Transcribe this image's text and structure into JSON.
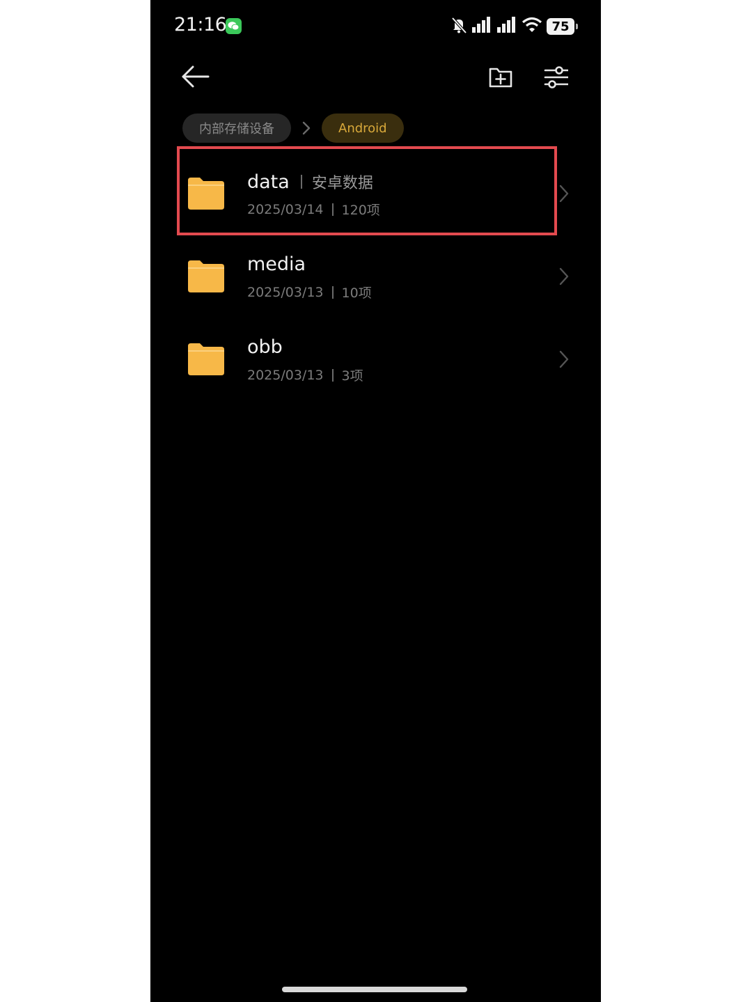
{
  "status_bar": {
    "time": "21:16",
    "notification_app_icon": "wechat-icon",
    "icons": [
      "mute-bell-icon",
      "signal-icon",
      "signal-icon",
      "wifi-icon"
    ],
    "battery_level": "75"
  },
  "toolbar": {
    "back_icon": "back-arrow-icon",
    "new_folder_icon": "new-folder-icon",
    "settings_icon": "sliders-icon"
  },
  "breadcrumb": {
    "root": "内部存储设备",
    "current": "Android"
  },
  "files": [
    {
      "name": "data",
      "alias": "安卓数据",
      "date": "2025/03/14",
      "count": "120项",
      "highlighted": true
    },
    {
      "name": "media",
      "date": "2025/03/13",
      "count": "10项"
    },
    {
      "name": "obb",
      "date": "2025/03/13",
      "count": "3项"
    }
  ],
  "colors": {
    "background": "#000000",
    "folder": "#f7b848",
    "breadcrumb_accent": "#d9a93a",
    "highlight_border": "#e34a4f"
  }
}
